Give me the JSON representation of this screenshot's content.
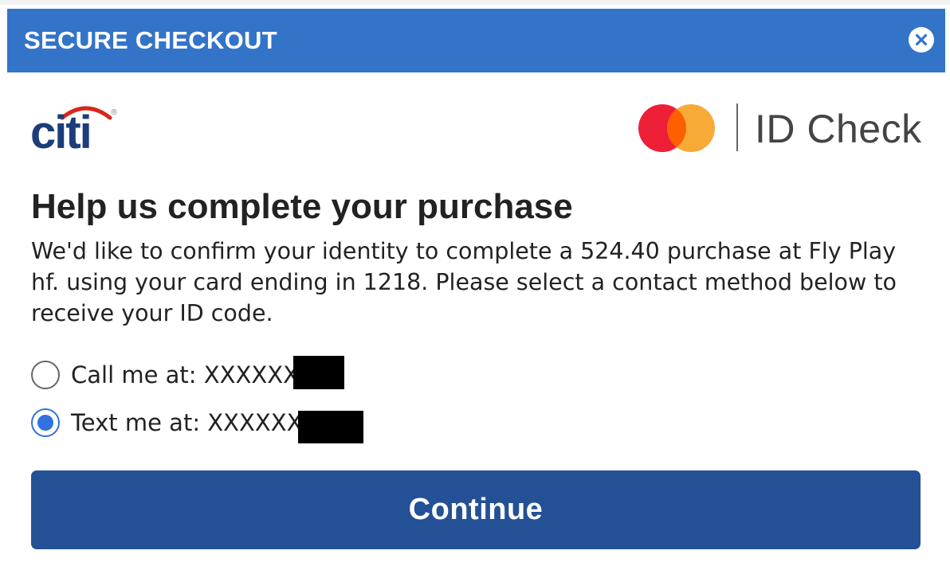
{
  "header": {
    "title": "SECURE CHECKOUT",
    "close_icon": "close-icon"
  },
  "logos": {
    "bank_text": "citi",
    "bank_mark": "®",
    "scheme_text": "ID Check",
    "scheme_icon": "mastercard-logo"
  },
  "content": {
    "heading": "Help us complete your purchase",
    "description": "We'd like to confirm your identity to complete a 524.40 purchase at Fly Play hf. using your card ending in 1218. Please select a contact method below to receive your ID code."
  },
  "contact_options": [
    {
      "label": "Call me at: XXXXXX9",
      "selected": false
    },
    {
      "label": "Text me at: XXXXXX",
      "selected": true
    }
  ],
  "actions": {
    "continue_label": "Continue"
  },
  "colors": {
    "header_bg": "#3374c9",
    "button_bg": "#245195",
    "radio_selected": "#2f72e0",
    "citi_blue": "#1d3d7a",
    "citi_red": "#d9261c",
    "mc_red": "#eb001b",
    "mc_orange": "#f79e1b"
  }
}
